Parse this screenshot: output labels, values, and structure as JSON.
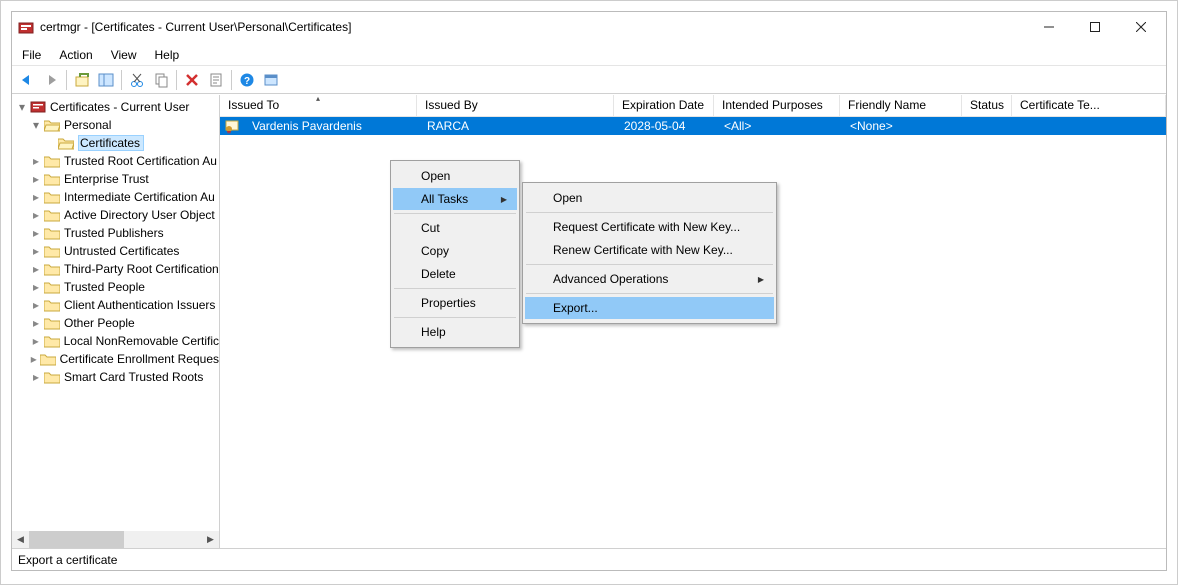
{
  "window": {
    "title": "certmgr - [Certificates - Current User\\Personal\\Certificates]"
  },
  "menu": {
    "file": "File",
    "action": "Action",
    "view": "View",
    "help": "Help"
  },
  "tree": {
    "root": "Certificates - Current User",
    "items": [
      {
        "label": "Personal"
      },
      {
        "label": "Certificates"
      },
      {
        "label": "Trusted Root Certification Au"
      },
      {
        "label": "Enterprise Trust"
      },
      {
        "label": "Intermediate Certification Au"
      },
      {
        "label": "Active Directory User Object"
      },
      {
        "label": "Trusted Publishers"
      },
      {
        "label": "Untrusted Certificates"
      },
      {
        "label": "Third-Party Root Certification"
      },
      {
        "label": "Trusted People"
      },
      {
        "label": "Client Authentication Issuers"
      },
      {
        "label": "Other People"
      },
      {
        "label": "Local NonRemovable Certific"
      },
      {
        "label": "Certificate Enrollment Reques"
      },
      {
        "label": "Smart Card Trusted Roots"
      }
    ]
  },
  "columns": {
    "issued_to": "Issued To",
    "issued_by": "Issued By",
    "expiration": "Expiration Date",
    "purposes": "Intended Purposes",
    "friendly": "Friendly Name",
    "status": "Status",
    "template": "Certificate Te..."
  },
  "rows": [
    {
      "issued_to": "Vardenis Pavardenis",
      "issued_by": "RARCA",
      "expiration": "2028-05-04",
      "purposes": "<All>",
      "friendly": "<None>",
      "status": "",
      "template": ""
    }
  ],
  "context_menu_1": {
    "open": "Open",
    "all_tasks": "All Tasks",
    "cut": "Cut",
    "copy": "Copy",
    "delete": "Delete",
    "properties": "Properties",
    "help": "Help"
  },
  "context_menu_2": {
    "open": "Open",
    "request": "Request Certificate with New Key...",
    "renew": "Renew Certificate with New Key...",
    "advanced": "Advanced Operations",
    "export": "Export..."
  },
  "statusbar": {
    "text": "Export a certificate"
  }
}
